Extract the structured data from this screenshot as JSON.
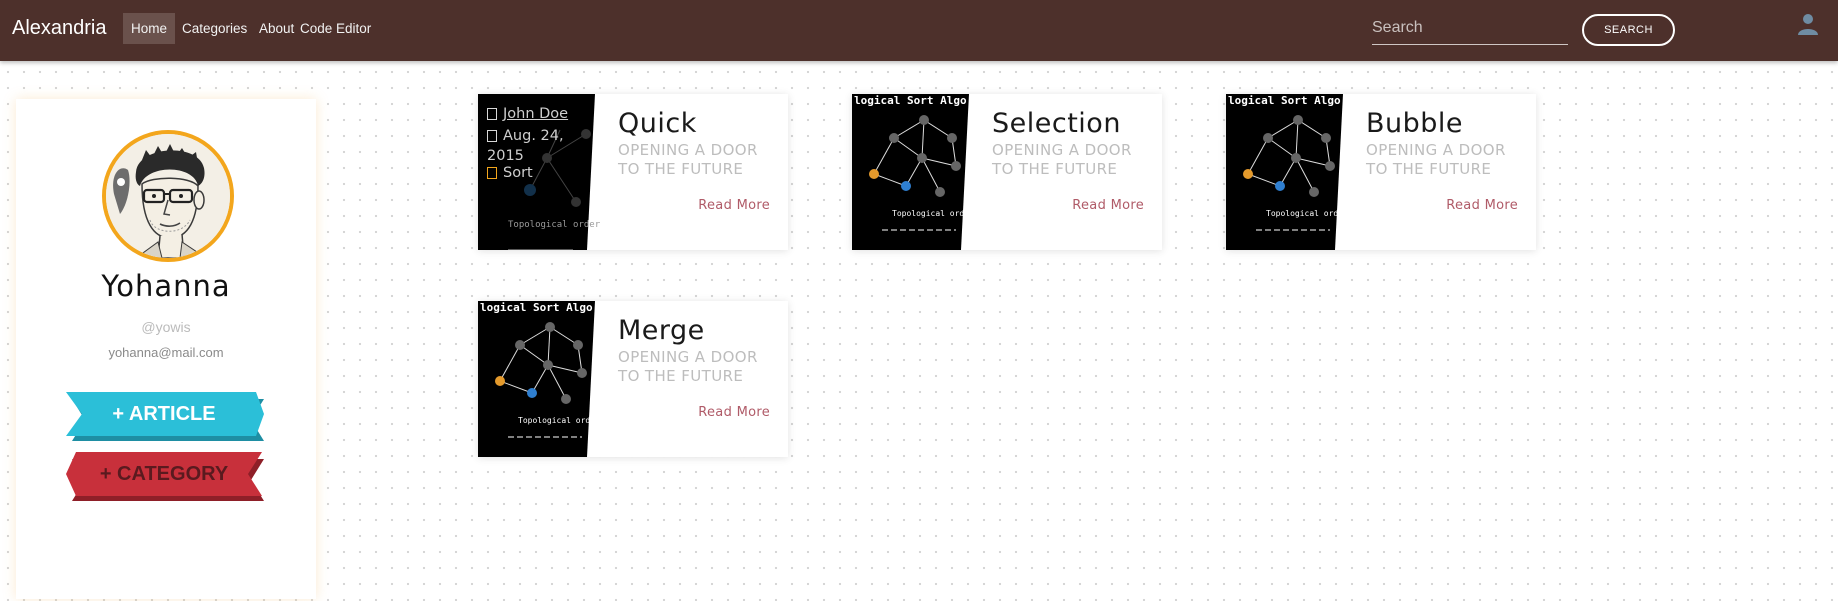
{
  "navbar": {
    "brand": "Alexandria",
    "links": [
      {
        "label": "Home",
        "active": true
      },
      {
        "label": "Categories"
      },
      {
        "label": "About"
      },
      {
        "label": "Code Editor"
      }
    ],
    "search_placeholder": "Search",
    "search_value": "",
    "search_button": "SEARCH",
    "user_icon": "user-icon"
  },
  "profile": {
    "name": "Yohanna",
    "handle": "@yowis",
    "email": "yohanna@mail.com",
    "add_article": "+ ARTICLE",
    "add_category": "+ CATEGORY"
  },
  "articles": [
    {
      "title": "Quick",
      "subtitle": "OPENING A DOOR TO THE FUTURE",
      "read_more": "Read More",
      "author": "John Doe",
      "date": "Aug. 24, 2015",
      "category": "Sort",
      "thumb_caption": "Topological order"
    },
    {
      "title": "Selection",
      "subtitle": "OPENING A DOOR TO THE FUTURE",
      "read_more": "Read More",
      "thumb_heading": "logical Sort Algo",
      "thumb_caption": "Topological order"
    },
    {
      "title": "Bubble",
      "subtitle": "OPENING A DOOR TO THE FUTURE",
      "read_more": "Read More",
      "thumb_heading": "logical Sort Algo",
      "thumb_caption": "Topological order"
    },
    {
      "title": "Merge",
      "subtitle": "OPENING A DOOR TO THE FUTURE",
      "read_more": "Read More",
      "thumb_heading": "logical Sort Algo",
      "thumb_caption": "Topological order"
    }
  ],
  "colors": {
    "navbar_bg": "#4d302b",
    "avatar_ring": "#f3a61c",
    "article_ribbon": "#2bbfd8",
    "category_ribbon": "#c8303b",
    "read_more": "#b05b68"
  }
}
